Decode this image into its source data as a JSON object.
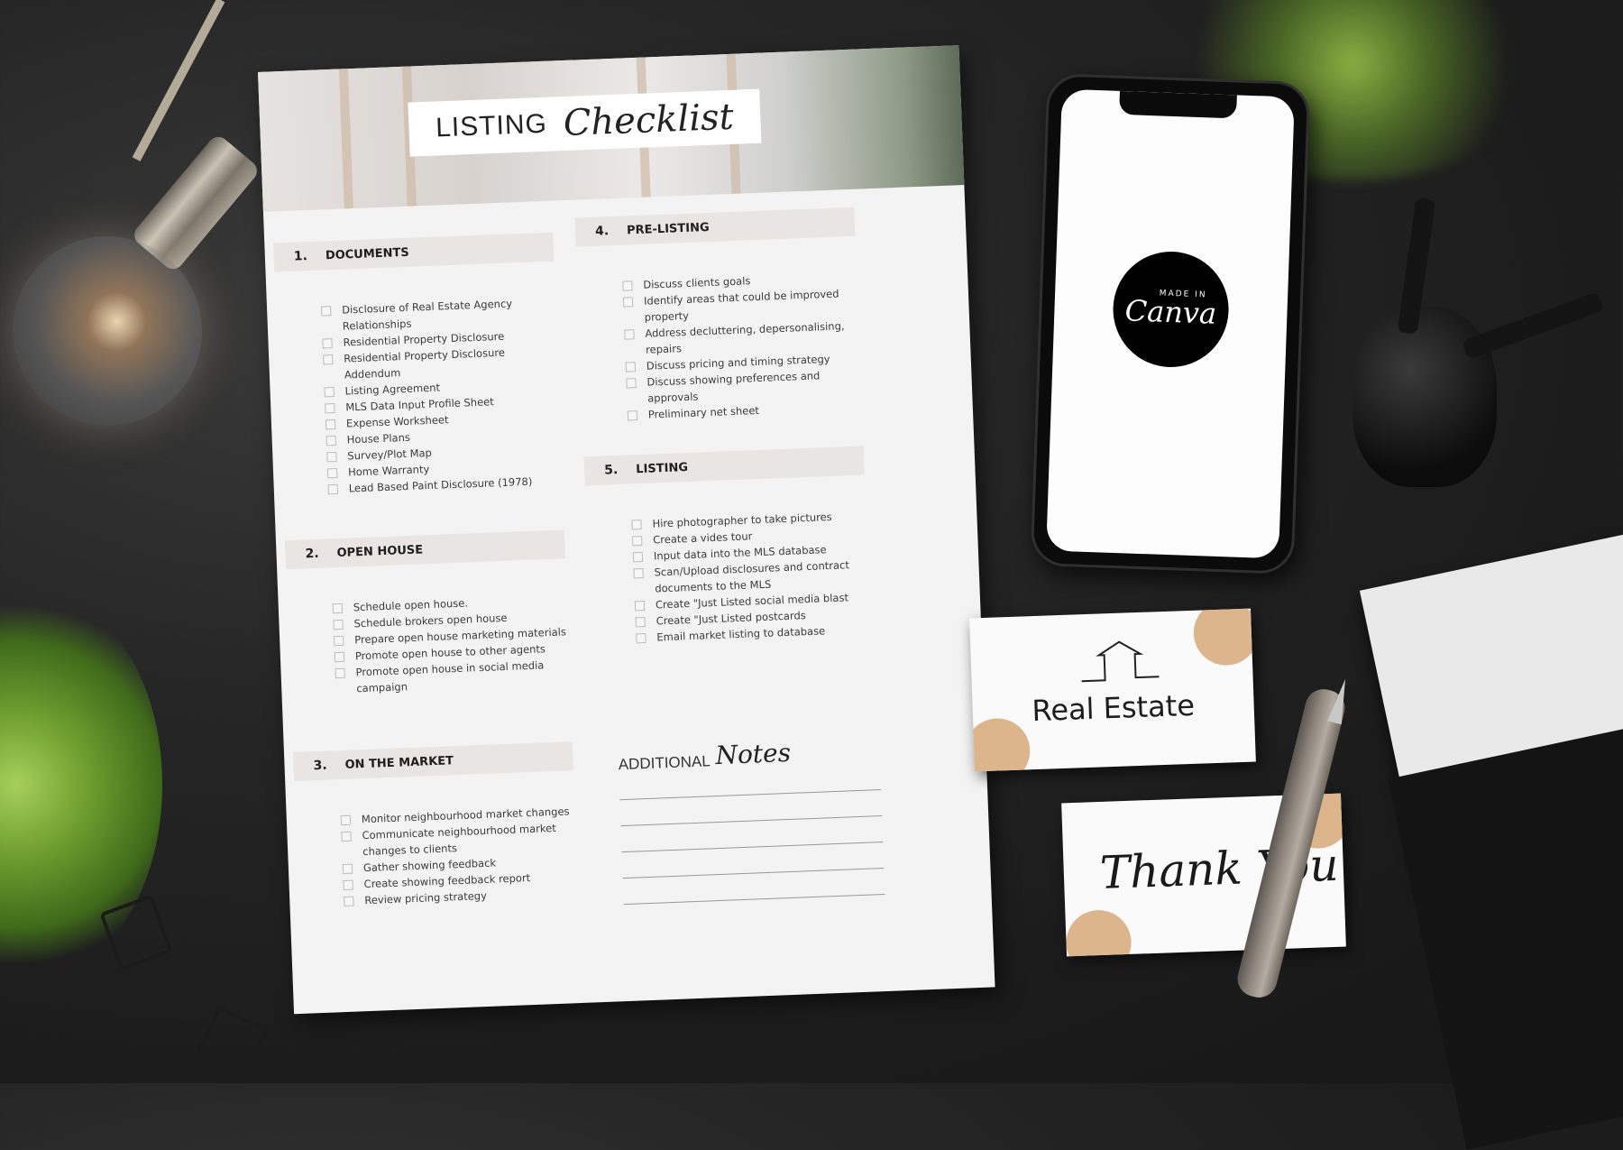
{
  "scene": "Flat-lay mockup of a real estate listing checklist on a dark desk",
  "checklist": {
    "title_main": "LISTING",
    "title_script": "Checklist",
    "sections": [
      {
        "number": "1.",
        "title": "DOCUMENTS",
        "items": [
          "Disclosure of Real Estate Agency Relationships",
          "Residential Property Disclosure",
          "Residential Property Disclosure Addendum",
          "Listing Agreement",
          "MLS Data Input Profile Sheet",
          "Expense Worksheet",
          "House Plans",
          "Survey/Plot Map",
          "Home Warranty",
          "Lead Based Paint Disclosure (1978)"
        ]
      },
      {
        "number": "2.",
        "title": "OPEN HOUSE",
        "items": [
          "Schedule open house.",
          "Schedule brokers open house",
          "Prepare open house marketing materials",
          "Promote open house to other agents",
          "Promote open house in social media campaign"
        ]
      },
      {
        "number": "3.",
        "title": "ON THE MARKET",
        "items": [
          "Monitor neighbourhood market changes",
          "Communicate neighbourhood market changes to clients",
          "Gather showing feedback",
          "Create showing feedback report",
          "Review pricing strategy"
        ]
      },
      {
        "number": "4.",
        "title": "PRE-LISTING",
        "items": [
          "Discuss clients goals",
          "Identify areas that could be improved property",
          "Address decluttering, depersonalising, repairs",
          "Discuss pricing and timing strategy",
          "Discuss showing preferences and approvals",
          "Preliminary net sheet"
        ]
      },
      {
        "number": "5.",
        "title": "LISTING",
        "items": [
          "Hire photographer to take pictures",
          "Create a vides tour",
          "Input data into the MLS database",
          "Scan/Upload disclosures and contract documents to the MLS",
          "Create \"Just Listed social media blast",
          "Create \"Just Listed postcards",
          "Email market listing to database"
        ]
      }
    ],
    "notes_main": "ADDITIONAL",
    "notes_script": "Notes",
    "notes_line_count": 5
  },
  "phone": {
    "badge_small": "MADE IN",
    "badge_large": "Canva"
  },
  "cards": {
    "business_card_text": "Real Estate",
    "business_card_icon": "house-outline-icon",
    "thank_you_text": "Thank You",
    "accent_color": "#dcb58c"
  },
  "colors": {
    "background": "#1c1c1c",
    "section_header_band": "#e8e5e2",
    "paper": "#f3f3f3"
  }
}
